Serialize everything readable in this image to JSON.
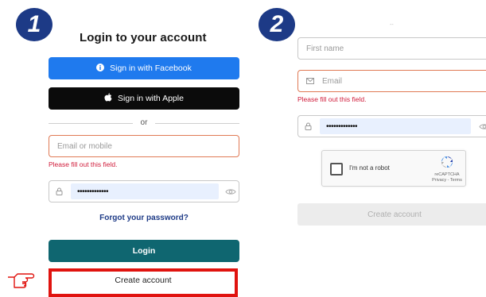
{
  "step1": {
    "badge": "1",
    "title": "Login to your account",
    "facebook_label": "Sign in with Facebook",
    "apple_label": "Sign in with Apple",
    "or_label": "or",
    "email_placeholder": "Email or mobile",
    "email_error": "Please fill out this field.",
    "password_value": "•••••••••••••",
    "forgot_label": "Forgot your password?",
    "login_label": "Login",
    "create_label": "Create account"
  },
  "step2": {
    "badge": "2",
    "top_hint": "--",
    "first_name_placeholder": "First name",
    "email_placeholder": "Email",
    "email_error": "Please fill out this field.",
    "password_value": "•••••••••••••",
    "captcha_label": "I'm not a robot",
    "captcha_brand": "reCAPTCHA",
    "captcha_links": "Privacy - Terms",
    "create_label": "Create account"
  },
  "colors": {
    "badge": "#1d3a86",
    "facebook": "#1f7aee",
    "apple": "#0b0b0b",
    "login": "#0f6670",
    "highlight": "#e0130f",
    "error": "#d01b3a"
  },
  "icons": [
    "pointing-hand-icon",
    "info-circle-icon",
    "apple-icon",
    "lock-icon",
    "eye-icon",
    "mail-icon",
    "recaptcha-icon"
  ]
}
